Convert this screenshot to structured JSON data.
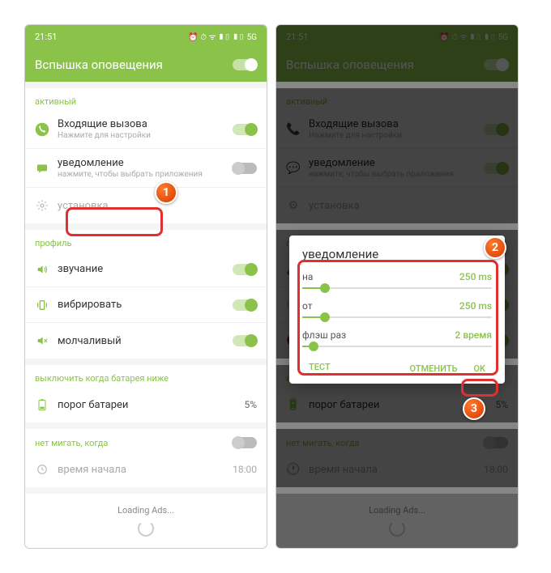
{
  "status": {
    "time": "21:51",
    "icons": "⏰ ⏱ ᯤ ▮▯ ▮▯ 5G"
  },
  "header": {
    "title": "Вспышка оповещения"
  },
  "s_active": {
    "label": "активный",
    "incoming": {
      "label": "Входящие вызова",
      "sub": "Нажмите для настройки"
    },
    "notif": {
      "label": "уведомление",
      "sub": "нажмите, чтобы выбрать приложения"
    },
    "setup": "установка"
  },
  "s_profile": {
    "label": "профиль",
    "sound": "звучание",
    "vibrate": "вибрировать",
    "silent": "молчаливый"
  },
  "s_battery": {
    "label": "выключить когда батарея ниже",
    "threshold": "порог батареи",
    "threshold_val": "5%"
  },
  "s_noflash": {
    "label": "нет мигать, когда",
    "start": "время начала",
    "start_val": "18:00"
  },
  "ads": "Loading Ads...",
  "modal": {
    "title": "уведомление",
    "on": {
      "label": "на",
      "val": "250 ms",
      "pct": 12
    },
    "off": {
      "label": "от",
      "val": "250 ms",
      "pct": 12
    },
    "times": {
      "label": "флэш раз",
      "val": "2 время",
      "pct": 6
    },
    "test": "тест",
    "cancel": "ОТМЕНИТЬ",
    "ok": "OK"
  },
  "badges": {
    "b1": "1",
    "b2": "2",
    "b3": "3"
  }
}
